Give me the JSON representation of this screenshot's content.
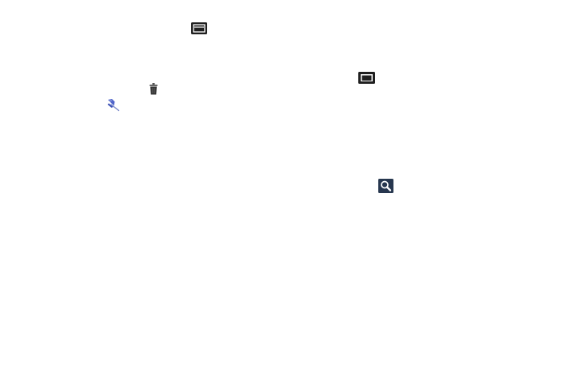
{
  "page": {
    "background": "#ffffff"
  },
  "icons": [
    {
      "name": "menu-key-icon",
      "color": "#1f1f1f"
    },
    {
      "name": "trash-icon",
      "color": "#3a3a3a"
    },
    {
      "name": "pin-icon",
      "color": "#4e63c9"
    },
    {
      "name": "home-key-icon",
      "color": "#1f1f1f"
    },
    {
      "name": "search-key-icon",
      "color": "#27374f"
    }
  ]
}
